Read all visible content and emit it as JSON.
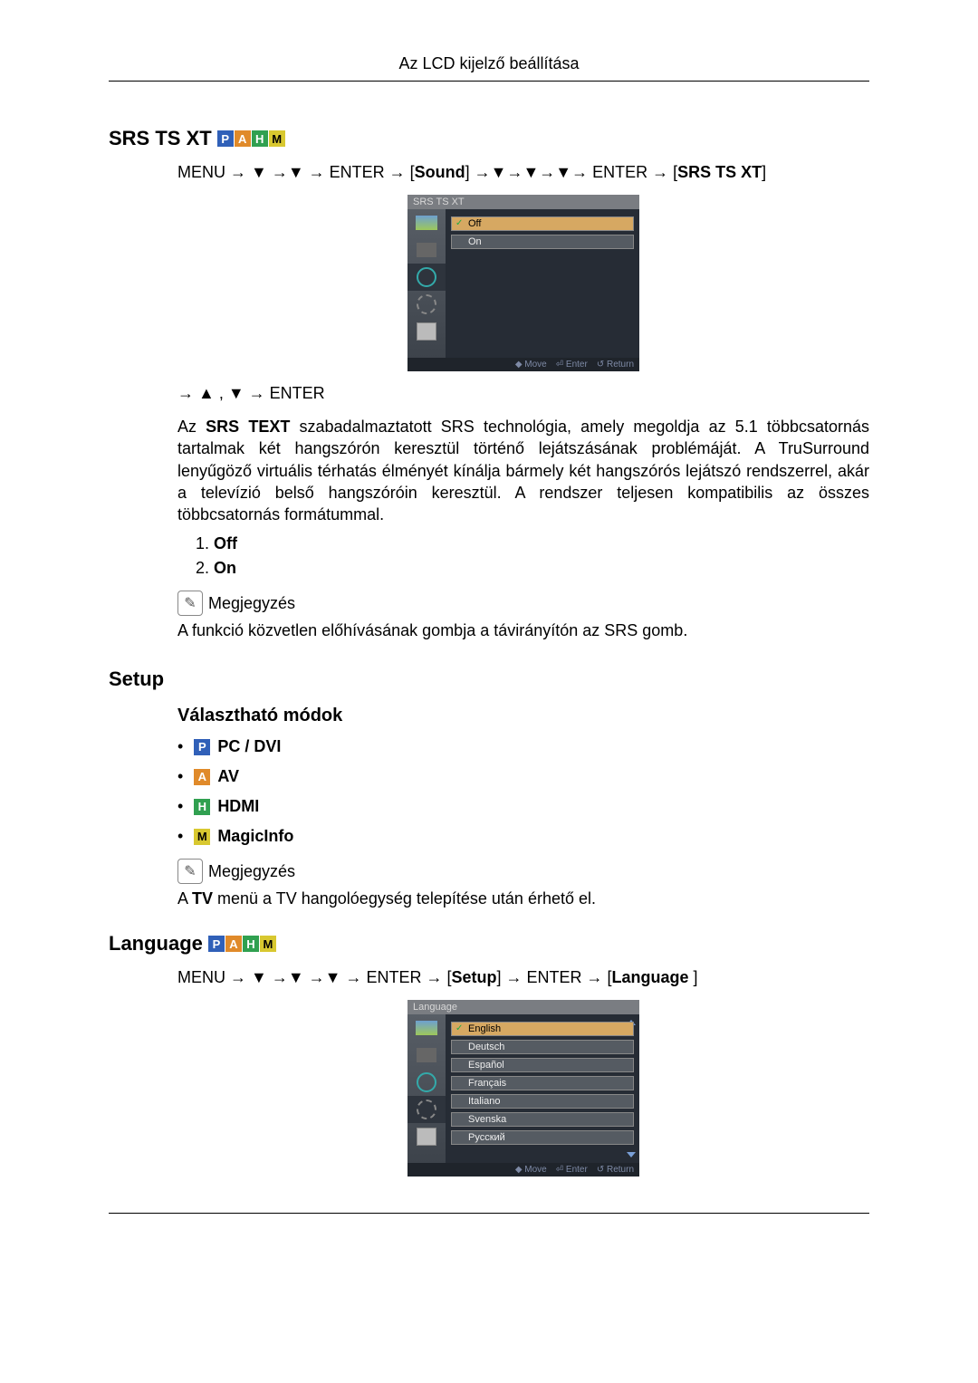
{
  "header": {
    "title": "Az LCD kijelző beállítása"
  },
  "section_srs": {
    "heading": "SRS TS XT",
    "path_prefix": "MENU → ▼ →▼ → ENTER → [",
    "path_sound": "Sound",
    "path_mid": "] →▼→▼→▼→ ENTER → [",
    "path_end": "SRS TS XT",
    "path_close": "]",
    "nav_line": "→ ▲ , ▼ → ENTER",
    "para_prefix": "Az ",
    "para_bold": "SRS TEXT",
    "para_rest": " szabadalmaztatott SRS technológia, amely megoldja az 5.1 többcsatornás tartalmak két hangszórón keresztül történő lejátszásának problémáját. A TruSurround lenyűgöző virtuális térhatás élményét kínálja bármely két hangszórós lejátszó rendszerrel, akár a televízió belső hangszóróin keresztül. A rendszer teljesen kompatibilis az összes többcsatornás formátummal.",
    "list": {
      "off": "Off",
      "on": "On"
    },
    "note_label": "Megjegyzés",
    "note_text": "A funkció közvetlen előhívásának gombja a távirányítón az SRS gomb."
  },
  "osd_srs": {
    "title": "SRS TS XT",
    "options": {
      "off": "Off",
      "on": "On"
    },
    "footer": {
      "move": "Move",
      "enter": "Enter",
      "return": "Return"
    }
  },
  "section_setup": {
    "heading": "Setup",
    "sub_heading": "Választható módok",
    "modes": {
      "pc_dvi": "PC / DVI",
      "av": "AV",
      "hdmi": "HDMI",
      "magicinfo": "MagicInfo"
    },
    "note_label": "Megjegyzés",
    "note_prefix": "A ",
    "note_bold": "TV",
    "note_rest": " menü a TV hangolóegység telepítése után érhető el."
  },
  "section_lang": {
    "heading": "Language",
    "path_prefix": "MENU → ▼ →▼ →▼ → ENTER → [",
    "path_setup": "Setup",
    "path_mid": "] → ENTER → [",
    "path_end": "Language",
    "path_close": " ]"
  },
  "osd_lang": {
    "title": "Language",
    "options": {
      "english": "English",
      "deutsch": "Deutsch",
      "espanol": "Español",
      "francais": "Français",
      "italiano": "Italiano",
      "svenska": "Svenska",
      "russkii": "Русский"
    },
    "footer": {
      "move": "Move",
      "enter": "Enter",
      "return": "Return"
    }
  }
}
